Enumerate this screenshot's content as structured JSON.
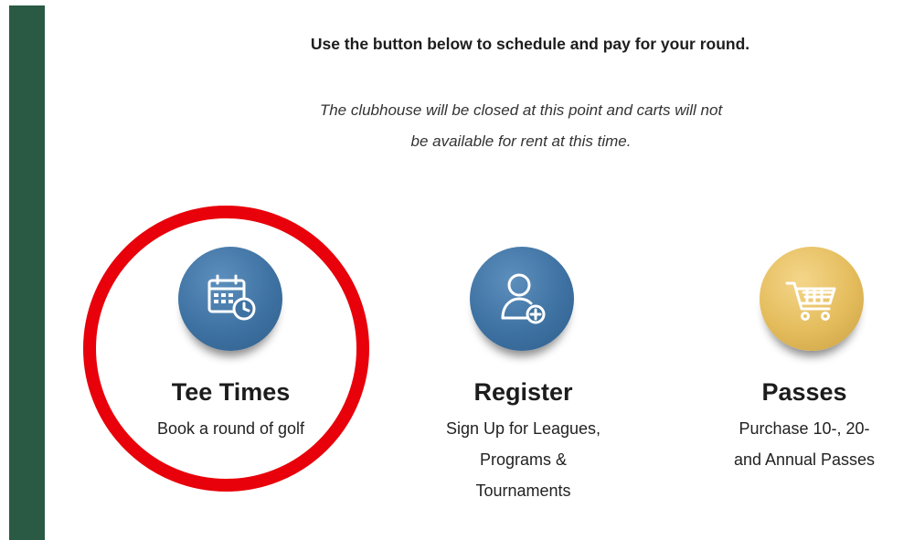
{
  "intro_text": "Use the button below to schedule and pay for your round.",
  "notice_line1": "The clubhouse will be closed at this point and carts will not",
  "notice_line2": "be available for rent at this time.",
  "tiles": {
    "tee_times": {
      "icon": "calendar-clock-icon",
      "color": "#3e72a2",
      "title": "Tee Times",
      "desc": [
        "Book a round of golf"
      ]
    },
    "register": {
      "icon": "user-add-icon",
      "color": "#3e72a2",
      "title": "Register",
      "desc": [
        "Sign Up for Leagues,",
        "Programs &",
        "Tournaments"
      ]
    },
    "passes": {
      "icon": "shopping-cart-icon",
      "color": "#e4bc5c",
      "title": "Passes",
      "desc": [
        "Purchase 10-, 20-",
        "and Annual Passes"
      ]
    }
  },
  "highlight_color": "#e8000a",
  "sidebar_color": "#2a5a44"
}
